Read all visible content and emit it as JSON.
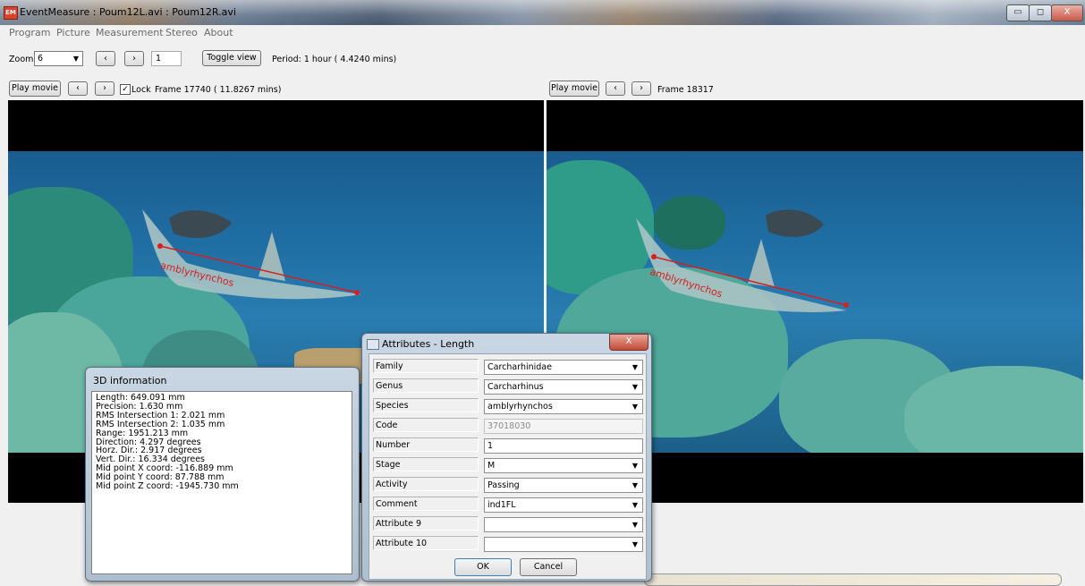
{
  "window": {
    "title": "EventMeasure : Poum12L.avi : Poum12R.avi",
    "app_icon": "EM",
    "controls": {
      "minimize": "▭",
      "maximize": "◻",
      "close": "X"
    }
  },
  "menu": [
    "Program",
    "Picture",
    "Measurement",
    "Stereo",
    "About"
  ],
  "toolbar": {
    "zoom_label": "Zoom",
    "zoom_value": "6",
    "prev": "‹",
    "next": "›",
    "step_value": "1",
    "toggle_view": "Toggle view",
    "period": "Period: 1 hour ( 4.4240 mins)"
  },
  "left_pane": {
    "play_label": "Play movie",
    "prev": "‹",
    "next": "›",
    "lock_label": "Lock",
    "lock_checked": true,
    "frame_text": "Frame 17740 ( 11.8267 mins)",
    "annotation": "amblyrhynchos"
  },
  "right_pane": {
    "play_label": "Play movie",
    "prev": "‹",
    "next": "›",
    "frame_text": "Frame 18317",
    "annotation": "amblyrhynchos"
  },
  "info_dialog": {
    "title": "3D information",
    "lines": [
      "Length: 649.091 mm",
      "Precision: 1.630 mm",
      "RMS Intersection 1: 2.021 mm",
      "RMS Intersection 2: 1.035 mm",
      "Range: 1951.213 mm",
      "Direction: 4.297 degrees",
      "Horz. Dir.: 2.917 degrees",
      "Vert. Dir.: 16.334 degrees",
      "Mid point X coord: -116.889 mm",
      "Mid point Y coord: 87.788 mm",
      "Mid point Z coord: -1945.730 mm"
    ]
  },
  "attributes_dialog": {
    "title": "Attributes - Length",
    "close": "X",
    "rows": [
      {
        "label": "Family",
        "value": "Carcharhinidae",
        "kind": "dropdown"
      },
      {
        "label": "Genus",
        "value": "Carcharhinus",
        "kind": "dropdown"
      },
      {
        "label": "Species",
        "value": "amblyrhynchos",
        "kind": "dropdown"
      },
      {
        "label": "Code",
        "value": "37018030",
        "kind": "readonly"
      },
      {
        "label": "Number",
        "value": "1",
        "kind": "text"
      },
      {
        "label": "Stage",
        "value": "M",
        "kind": "dropdown"
      },
      {
        "label": "Activity",
        "value": "Passing",
        "kind": "dropdown"
      },
      {
        "label": "Comment",
        "value": "ind1FL",
        "kind": "combo"
      },
      {
        "label": "Attribute 9",
        "value": "",
        "kind": "combo"
      },
      {
        "label": "Attribute 10",
        "value": "",
        "kind": "combo"
      }
    ],
    "ok": "OK",
    "cancel": "Cancel"
  },
  "colors": {
    "measurement_line": "#d81e1e",
    "water": "#1f6ea3",
    "dialog_border": "#5d6f80"
  }
}
